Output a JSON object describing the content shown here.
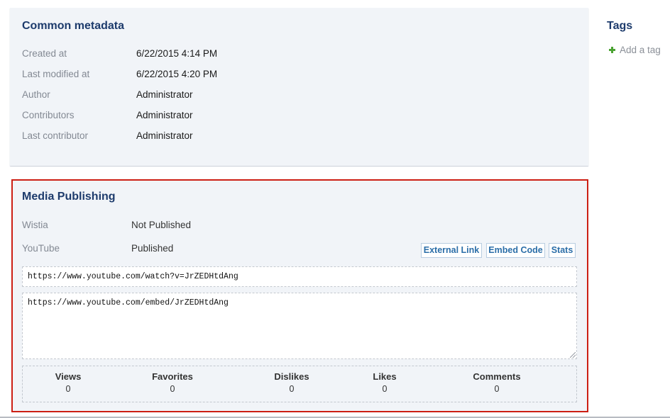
{
  "common_metadata": {
    "title": "Common metadata",
    "rows": [
      {
        "label": "Created at",
        "value": "6/22/2015 4:14 PM"
      },
      {
        "label": "Last modified at",
        "value": "6/22/2015 4:20 PM"
      },
      {
        "label": "Author",
        "value": "Administrator"
      },
      {
        "label": "Contributors",
        "value": "Administrator"
      },
      {
        "label": "Last contributor",
        "value": "Administrator"
      }
    ]
  },
  "tags": {
    "title": "Tags",
    "add_label": "Add a tag",
    "add_icon": "plus-icon",
    "add_icon_color": "#4aa332"
  },
  "media_publishing": {
    "title": "Media Publishing",
    "highlight_color": "#cc1f14",
    "providers": [
      {
        "label": "Wistia",
        "status": "Not Published"
      },
      {
        "label": "YouTube",
        "status": "Published"
      }
    ],
    "buttons": {
      "external_link": "External Link",
      "embed_code": "Embed Code",
      "stats": "Stats"
    },
    "external_url": "https://www.youtube.com/watch?v=JrZEDHtdAng",
    "embed_url": "https://www.youtube.com/embed/JrZEDHtdAng",
    "stats": [
      {
        "label": "Views",
        "value": "0"
      },
      {
        "label": "Favorites",
        "value": "0"
      },
      {
        "label": "Dislikes",
        "value": "0"
      },
      {
        "label": "Likes",
        "value": "0"
      },
      {
        "label": "Comments",
        "value": "0"
      }
    ]
  }
}
